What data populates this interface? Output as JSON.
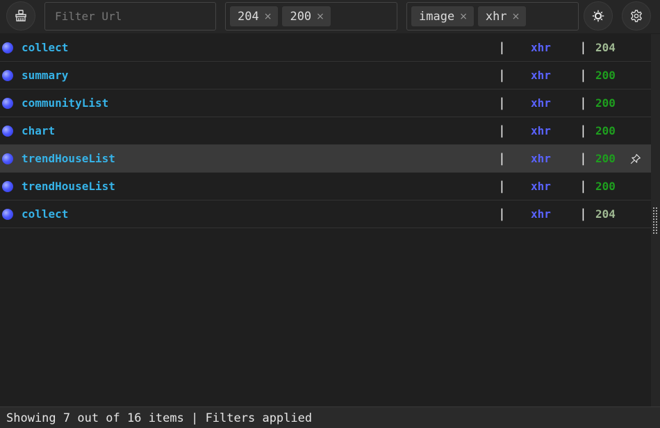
{
  "toolbar": {
    "clear_icon": "broom-icon",
    "filter_placeholder": "Filter Url",
    "status_filters": [
      {
        "label": "204"
      },
      {
        "label": "200"
      }
    ],
    "type_filters": [
      {
        "label": "image"
      },
      {
        "label": "xhr"
      }
    ],
    "remove_glyph": "×",
    "theme_icon": "sun-icon",
    "settings_icon": "gear-icon"
  },
  "rows": [
    {
      "name": "collect",
      "sep": "|",
      "type": "xhr",
      "sep2": "|",
      "status": "204"
    },
    {
      "name": "summary",
      "sep": "|",
      "type": "xhr",
      "sep2": "|",
      "status": "200"
    },
    {
      "name": "communityList",
      "sep": "|",
      "type": "xhr",
      "sep2": "|",
      "status": "200"
    },
    {
      "name": "chart",
      "sep": "|",
      "type": "xhr",
      "sep2": "|",
      "status": "200"
    },
    {
      "name": "trendHouseList",
      "sep": "|",
      "type": "xhr",
      "sep2": "|",
      "status": "200",
      "hovered": true,
      "pin_icon": "pin-icon"
    },
    {
      "name": "trendHouseList",
      "sep": "|",
      "type": "xhr",
      "sep2": "|",
      "status": "200"
    },
    {
      "name": "collect",
      "sep": "|",
      "type": "xhr",
      "sep2": "|",
      "status": "204"
    }
  ],
  "colors": {
    "name": "#36b3e8",
    "type": "#5a63ff",
    "status_200": "#1e9e1e",
    "status_204": "#9fb992"
  },
  "footer": {
    "text": "Showing 7 out of 16 items | Filters applied"
  }
}
